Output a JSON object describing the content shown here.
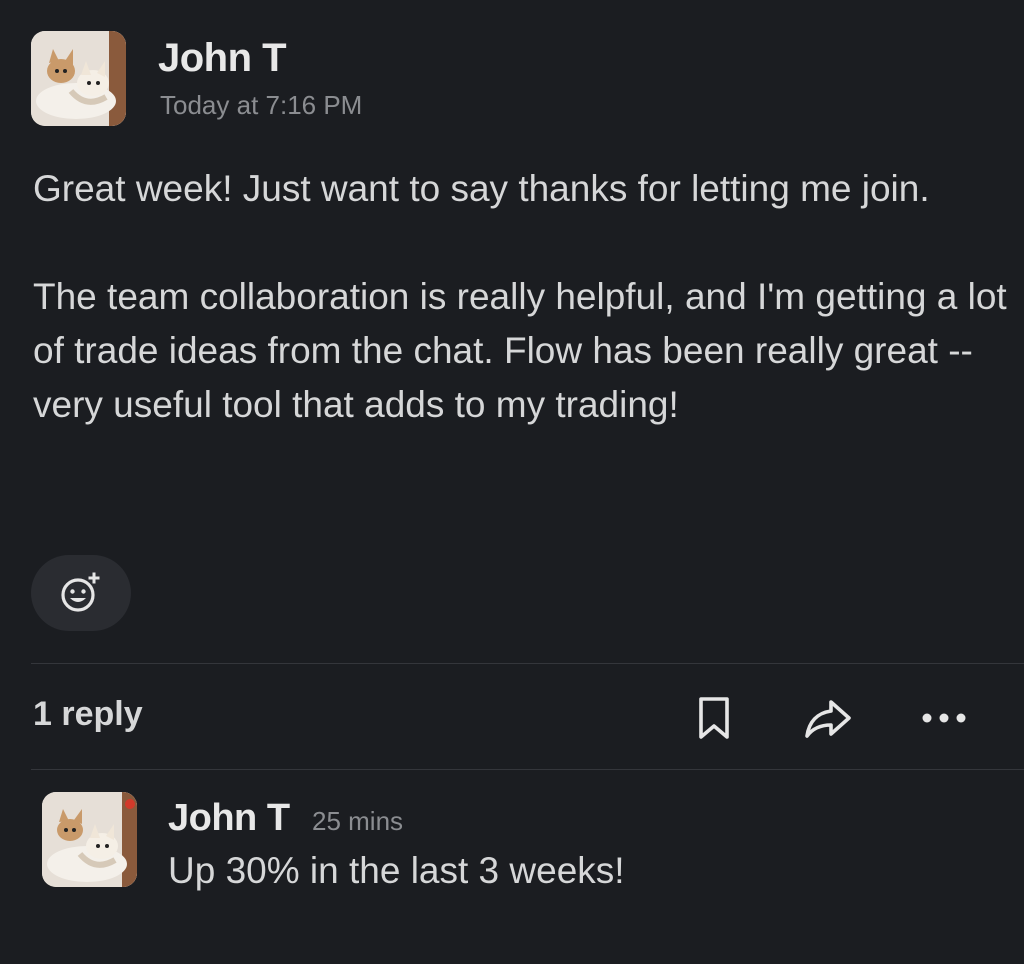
{
  "message": {
    "author": "John T",
    "timestamp": "Today at 7:16 PM",
    "avatar_icon": "dog-photo-avatar",
    "paragraphs": [
      "Great week! Just want to say thanks for letting me join.",
      "The team collaboration is really helpful, and I'm getting a lot of trade ideas from the chat. Flow has been really great -- very useful tool that adds to my trading!"
    ],
    "reaction_icon": "add-reaction-icon"
  },
  "thread": {
    "reply_count_label": "1 reply",
    "actions": {
      "bookmark_icon": "bookmark-icon",
      "share_icon": "share-icon",
      "more_icon": "more-icon"
    }
  },
  "reply": {
    "author": "John T",
    "timestamp": "25 mins",
    "avatar_icon": "dog-photo-avatar",
    "text": "Up 30% in the last 3 weeks!"
  },
  "colors": {
    "background": "#1b1d21",
    "text_primary": "#d6d7d8",
    "text_muted": "#8b8d91",
    "pill_background": "#2a2c31",
    "divider": "#34363b"
  }
}
